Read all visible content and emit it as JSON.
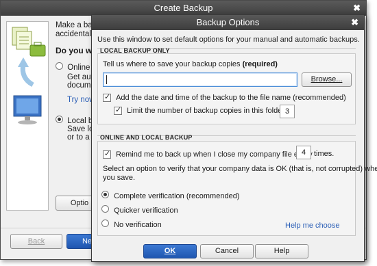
{
  "back_window": {
    "title": "Create Backup",
    "close_glyph": "✖",
    "intro_line1": "Make a bac",
    "intro_line2": "accidental l",
    "question": "Do you wa",
    "online_label": "Online ba",
    "online_desc1": "Get auto",
    "online_desc2": "documer",
    "try_now": "Try now",
    "local_label": "Local bac",
    "local_desc1": "Save loc",
    "local_desc2": "or to a fo",
    "options_button": "Optio",
    "back_button": "Back",
    "next_button": "Ne"
  },
  "front_window": {
    "title": "Backup Options",
    "close_glyph": "✖",
    "description": "Use this window to set default options for your manual and automatic backups.",
    "local_section": {
      "title": "LOCAL BACKUP ONLY",
      "prompt": "Tell us where to save your backup copies ",
      "prompt_required": "(required)",
      "path_value": "",
      "browse_button": "Browse...",
      "add_datetime": {
        "label": "Add the date and time of the backup to the file name (recommended)",
        "checked": true
      },
      "limit_copies": {
        "label": "Limit the number of backup copies in this folder to",
        "checked": true,
        "value": "3"
      }
    },
    "online_section": {
      "title": "ONLINE AND LOCAL BACKUP",
      "remind": {
        "label": "Remind me to back up when I close my company file every",
        "checked": true,
        "value": "4",
        "suffix": "times."
      },
      "verify_prompt_line1": "Select an option to verify that your company data is OK (that is, not corrupted) when",
      "verify_prompt_line2": "you save.",
      "options": [
        {
          "label": "Complete verification (recommended)",
          "selected": true
        },
        {
          "label": "Quicker verification",
          "selected": false
        },
        {
          "label": "No verification",
          "selected": false
        }
      ],
      "help_link": "Help me choose"
    },
    "buttons": {
      "ok": "OK",
      "cancel": "Cancel",
      "help": "Help"
    }
  }
}
